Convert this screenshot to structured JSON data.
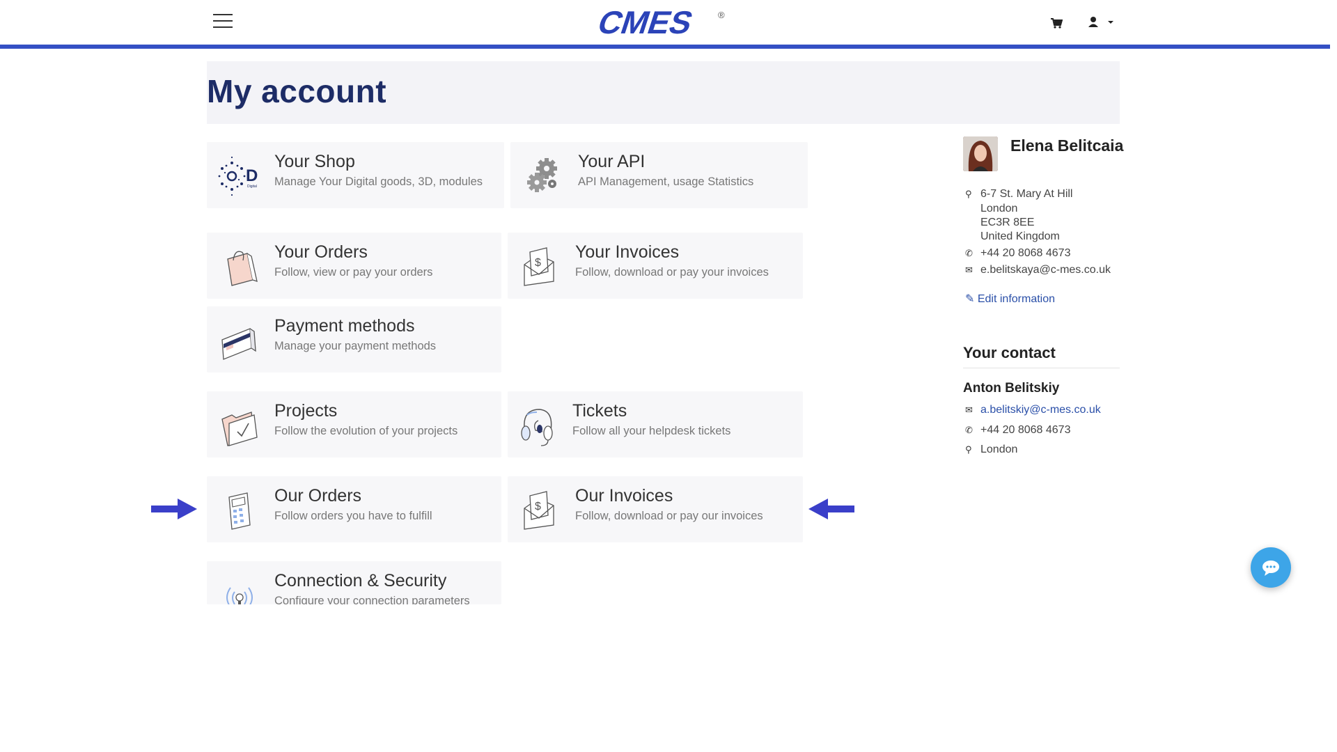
{
  "header": {
    "menu_icon": "hamburger-icon",
    "logo_text": "CMES",
    "logo_mark": "®",
    "cart_icon": "cart-icon",
    "user_icon": "user-icon"
  },
  "page": {
    "title": "My account"
  },
  "cards": {
    "shop": {
      "title": "Your Shop",
      "subtitle": "Manage Your Digital goods, 3D, modules",
      "icon": "3d-digital-icon"
    },
    "api": {
      "title": "Your API",
      "subtitle": "API Management, usage Statistics",
      "icon": "gears-icon"
    },
    "orders": {
      "title": "Your Orders",
      "subtitle": "Follow, view or pay your orders",
      "icon": "shopping-bag-icon"
    },
    "invoices": {
      "title": "Your Invoices",
      "subtitle": "Follow, download or pay your invoices",
      "icon": "invoice-envelope-icon"
    },
    "payment": {
      "title": "Payment methods",
      "subtitle": "Manage your payment methods",
      "icon": "credit-card-icon"
    },
    "projects": {
      "title": "Projects",
      "subtitle": "Follow the evolution of your projects",
      "icon": "folder-check-icon"
    },
    "tickets": {
      "title": "Tickets",
      "subtitle": "Follow all your helpdesk tickets",
      "icon": "headset-icon"
    },
    "our_orders": {
      "title": "Our Orders",
      "subtitle": "Follow orders you have to fulfill",
      "icon": "calculator-icon"
    },
    "our_invoices": {
      "title": "Our Invoices",
      "subtitle": "Follow, download or pay our invoices",
      "icon": "invoice-envelope-icon"
    },
    "connection": {
      "title": "Connection & Security",
      "subtitle": "Configure your connection parameters",
      "icon": "signal-icon"
    }
  },
  "profile": {
    "name": "Elena Belitcaia",
    "address": [
      "6-7 St. Mary At Hill",
      "London",
      "EC3R 8EE",
      "United Kingdom"
    ],
    "phone": "+44 20 8068 4673",
    "email": "e.belitskaya@c-mes.co.uk",
    "edit_label": "Edit information"
  },
  "contact": {
    "heading": "Your contact",
    "name": "Anton Belitskiy",
    "email": "a.belitskiy@c-mes.co.uk",
    "phone": "+44 20 8068 4673",
    "city": "London"
  },
  "colors": {
    "accent": "#3450c4",
    "title": "#1d2c66",
    "arrow": "#3a3fc9",
    "chat": "#3da5e8"
  }
}
